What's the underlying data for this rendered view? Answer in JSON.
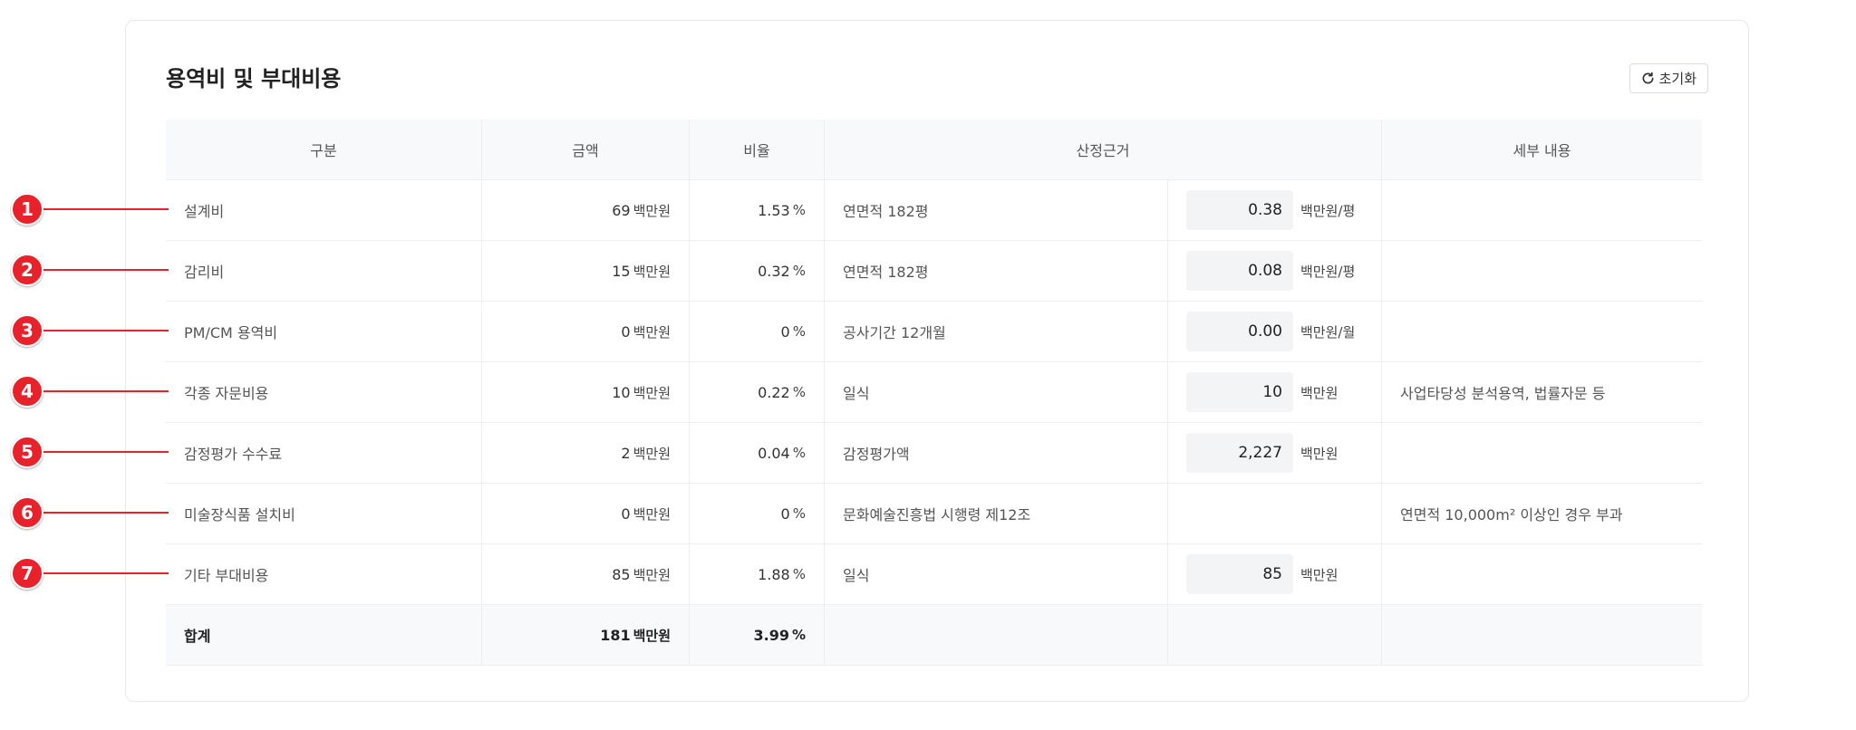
{
  "card": {
    "title": "용역비 및 부대비용",
    "reset_label": "초기화"
  },
  "table": {
    "headers": [
      "구분",
      "금액",
      "비율",
      "산정근거",
      "세부 내용"
    ],
    "rows": [
      {
        "name": "설계비",
        "amount": "69",
        "unit": "백만원",
        "ratio": "1.53",
        "pct": "%",
        "basis": "연면적 182평",
        "value": "0.38",
        "value_unit": "백만원/평",
        "detail": ""
      },
      {
        "name": "감리비",
        "amount": "15",
        "unit": "백만원",
        "ratio": "0.32",
        "pct": "%",
        "basis": "연면적 182평",
        "value": "0.08",
        "value_unit": "백만원/평",
        "detail": ""
      },
      {
        "name": "PM/CM 용역비",
        "amount": "0",
        "unit": "백만원",
        "ratio": "0",
        "pct": "%",
        "basis": "공사기간 12개월",
        "value": "0.00",
        "value_unit": "백만원/월",
        "detail": ""
      },
      {
        "name": "각종 자문비용",
        "amount": "10",
        "unit": "백만원",
        "ratio": "0.22",
        "pct": "%",
        "basis": "일식",
        "value": "10",
        "value_unit": "백만원",
        "detail": "사업타당성 분석용역, 법률자문 등"
      },
      {
        "name": "감정평가 수수료",
        "amount": "2",
        "unit": "백만원",
        "ratio": "0.04",
        "pct": "%",
        "basis": "감정평가액",
        "value": "2,227",
        "value_unit": "백만원",
        "detail": ""
      },
      {
        "name": "미술장식품 설치비",
        "amount": "0",
        "unit": "백만원",
        "ratio": "0",
        "pct": "%",
        "basis": "문화예술진흥법 시행령 제12조",
        "value": "",
        "value_unit": "",
        "detail": "연면적 10,000m² 이상인 경우 부과"
      },
      {
        "name": "기타 부대비용",
        "amount": "85",
        "unit": "백만원",
        "ratio": "1.88",
        "pct": "%",
        "basis": "일식",
        "value": "85",
        "value_unit": "백만원",
        "detail": ""
      }
    ],
    "total": {
      "name": "합계",
      "amount": "181",
      "unit": "백만원",
      "ratio": "3.99",
      "pct": "%"
    }
  },
  "callouts": [
    "1",
    "2",
    "3",
    "4",
    "5",
    "6",
    "7"
  ],
  "colors": {
    "accent": "#e8222a",
    "header_bg": "#f8f9fb",
    "input_bg": "#f3f4f6"
  },
  "icons": {
    "reset": "refresh-icon"
  }
}
